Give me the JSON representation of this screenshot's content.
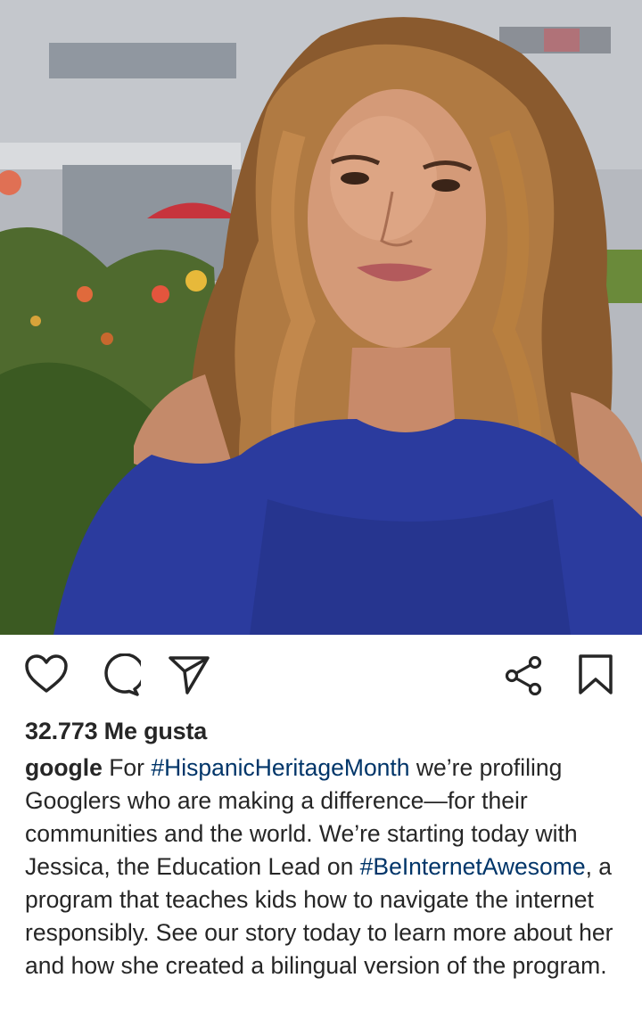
{
  "post": {
    "image_alt": "Smiling woman with long curly hair wearing a blue top, outdoors with flowers and a building behind her",
    "actions": {
      "like_icon": "heart-icon",
      "comment_icon": "comment-icon",
      "share_icon": "paper-plane-icon",
      "collections_icon": "share-nodes-icon",
      "save_icon": "bookmark-icon"
    },
    "likes": "32.773 Me gusta",
    "caption": {
      "username": "google",
      "text_1": " For ",
      "hashtag_1": "#HispanicHeritageMonth",
      "text_2": " we’re profiling Googlers who are making a difference—for their communities and the world. We’re starting today with Jessica, the Education Lead on ",
      "hashtag_2": "#BeInternetAwesome",
      "text_3": ", a program that teaches kids how to navigate the internet responsibly. See our story today to learn more about her and how she created a bilingual version of the program."
    }
  },
  "colors": {
    "text": "#262626",
    "hashtag": "#003569",
    "background": "#ffffff"
  }
}
